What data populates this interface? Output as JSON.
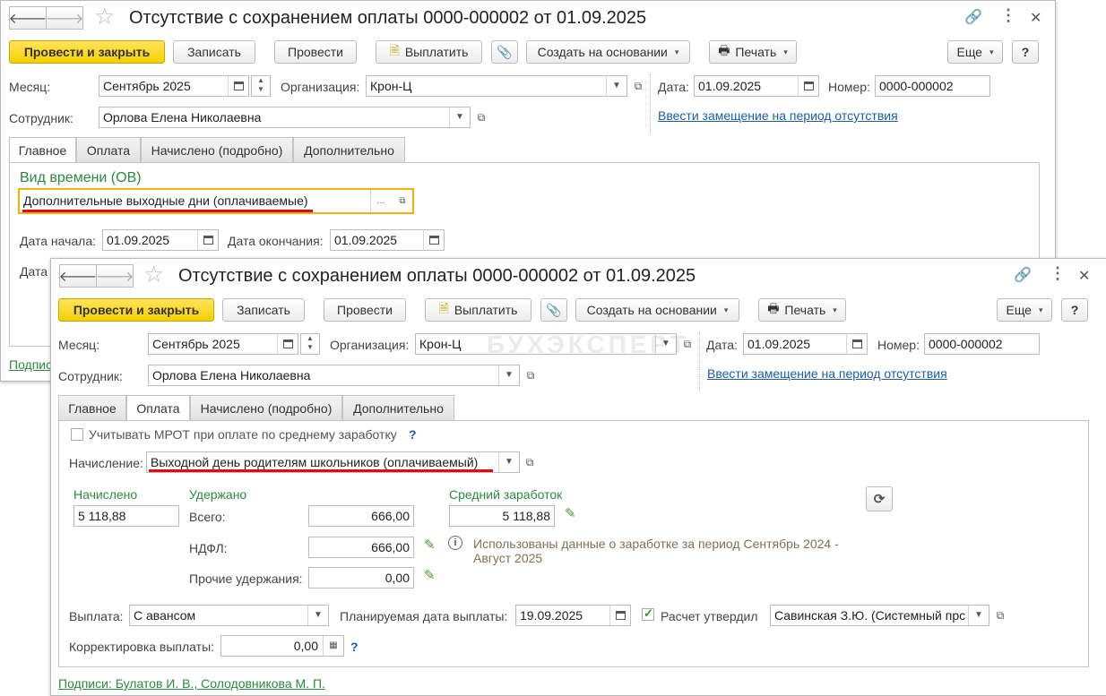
{
  "title": "Отсутствие с сохранением оплаты 0000-000002 от 01.09.2025",
  "toolbar": {
    "post_close": "Провести и закрыть",
    "save": "Записать",
    "post": "Провести",
    "pay": "Выплатить",
    "create_based": "Создать на основании",
    "print": "Печать",
    "more": "Еще",
    "help": "?"
  },
  "header": {
    "month_label": "Месяц:",
    "month_value": "Сентябрь 2025",
    "org_label": "Организация:",
    "org_value": "Крон-Ц",
    "date_label": "Дата:",
    "date_value": "01.09.2025",
    "number_label": "Номер:",
    "number_value": "0000-000002",
    "employee_label": "Сотрудник:",
    "employee_value": "Орлова Елена Николаевна",
    "substitution_link": "Ввести замещение на период отсутствия"
  },
  "tabs": [
    "Главное",
    "Оплата",
    "Начислено (подробно)",
    "Дополнительно"
  ],
  "back_window": {
    "time_type_label": "Вид времени (ОВ)",
    "time_type_value": "Дополнительные выходные дни (оплачиваемые)",
    "start_label": "Дата начала:",
    "start_value": "01.09.2025",
    "end_label": "Дата окончания:",
    "end_value": "01.09.2025",
    "partial_label": "Дата",
    "signatures_partial": "Подпис"
  },
  "watermark": "БУХЭКСПЕРТ",
  "payment_tab": {
    "mrot_label": "Учитывать МРОТ при оплате по среднему заработку",
    "mrot_help": "?",
    "accrual_label": "Начисление:",
    "accrual_value": "Выходной день родителям школьников (оплачиваемый)",
    "accrued_label": "Начислено",
    "accrued_value": "5 118,88",
    "withheld_label": "Удержано",
    "total_label": "Всего:",
    "total_value": "666,00",
    "ndfl_label": "НДФЛ:",
    "ndfl_value": "666,00",
    "other_label": "Прочие удержания:",
    "other_value": "0,00",
    "avg_label": "Средний заработок",
    "avg_value": "5 118,88",
    "info_line1": "Использованы данные о заработке за период Сентябрь 2024 -",
    "info_line2": "Август 2025",
    "payout_label": "Выплата:",
    "payout_value": "С авансом",
    "planned_date_label": "Планируемая дата выплаты:",
    "planned_date_value": "19.09.2025",
    "approved_label": "Расчет утвердил",
    "approved_checked": true,
    "approver_value": "Савинская З.Ю. (Системный прс",
    "correction_label": "Корректировка выплаты:",
    "correction_value": "0,00",
    "correction_help": "?"
  },
  "signatures": "Подписи: Булатов И. В., Солодовникова М. П."
}
